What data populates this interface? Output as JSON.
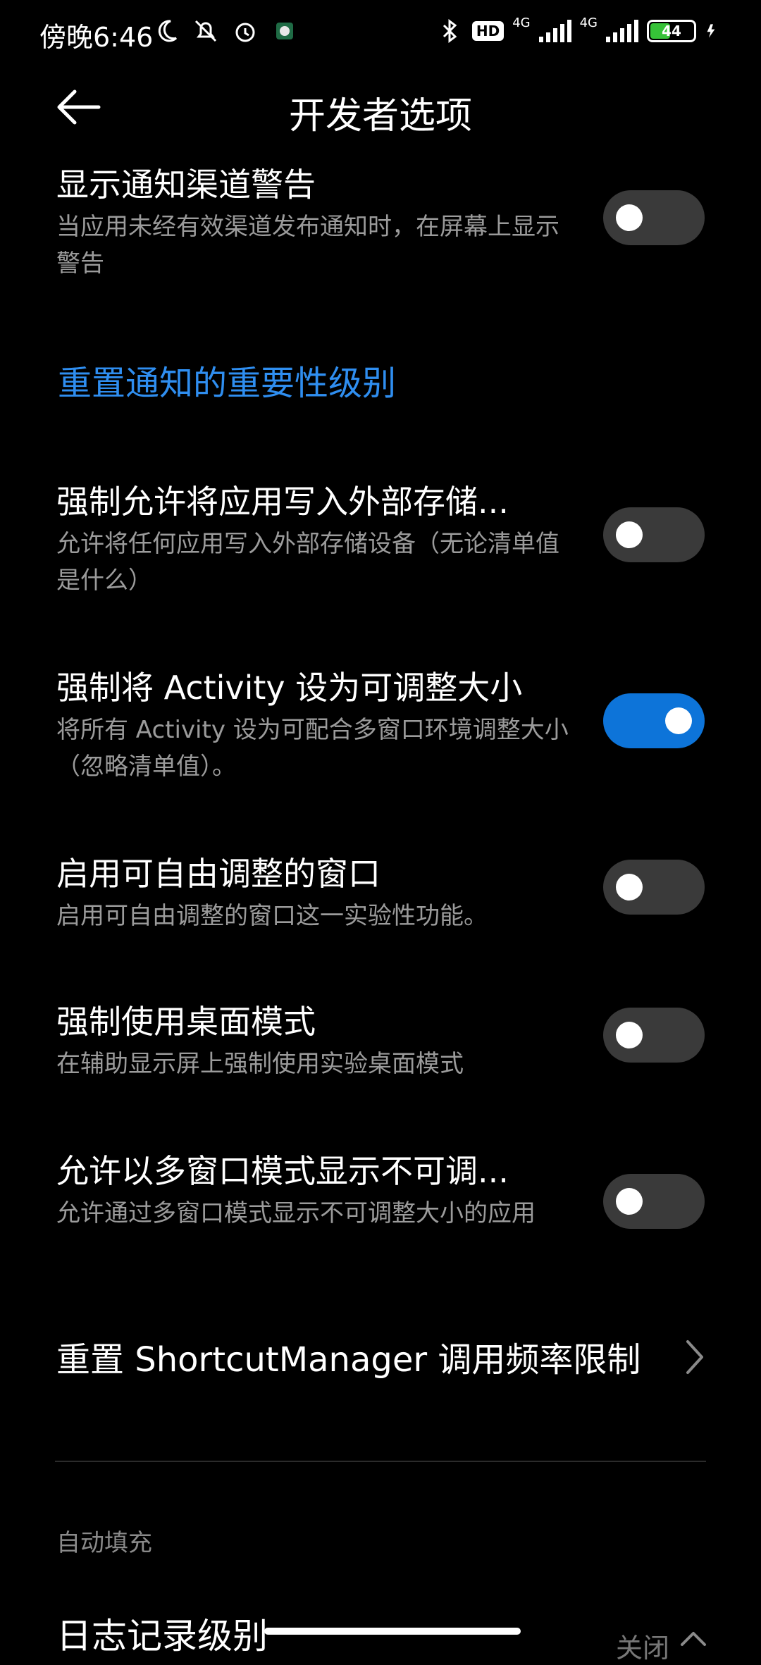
{
  "status_bar": {
    "time": "傍晚6:46",
    "battery_level": "44",
    "network_type_1": "4G",
    "network_type_2": "4G",
    "hd_label": "HD",
    "left_icons": [
      "moon-icon",
      "bell-off-icon",
      "alarm-icon",
      "app-icon"
    ],
    "right_icons": [
      "bluetooth-icon",
      "hd-icon",
      "signal-icon",
      "signal-icon",
      "battery-icon",
      "charging-icon"
    ]
  },
  "header": {
    "title": "开发者选项",
    "back_icon": "arrow-left-icon"
  },
  "items": [
    {
      "title": "显示通知渠道警告",
      "subtitle": "当应用未经有效渠道发布通知时，在屏幕上显示警告",
      "enabled": false
    },
    {
      "title": "强制允许将应用写入外部存储...",
      "subtitle": "允许将任何应用写入外部存储设备（无论清单值是什么）",
      "enabled": false
    },
    {
      "title": "强制将 Activity 设为可调整大小",
      "subtitle": "将所有 Activity 设为可配合多窗口环境调整大小（忽略清单值）。",
      "enabled": true
    },
    {
      "title": "启用可自由调整的窗口",
      "subtitle": "启用可自由调整的窗口这一实验性功能。",
      "enabled": false
    },
    {
      "title": "强制使用桌面模式",
      "subtitle": "在辅助显示屏上强制使用实验桌面模式",
      "enabled": false
    },
    {
      "title": "允许以多窗口模式显示不可调...",
      "subtitle": "允许通过多窗口模式显示不可调整大小的应用",
      "enabled": false
    }
  ],
  "reset_importance_link": "重置通知的重要性级别",
  "shortcut_reset": {
    "title": "重置 ShortcutManager 调用频率限制",
    "icon": "chevron-right-icon"
  },
  "section_autofill": "自动填充",
  "log_level": {
    "title": "日志记录级别",
    "value": "关闭",
    "icon": "chevron-up-icon"
  },
  "colors": {
    "accent": "#0d74d9",
    "link": "#2f8ef0",
    "switch_off": "#3a3a3a",
    "battery_fill": "#36c238"
  }
}
